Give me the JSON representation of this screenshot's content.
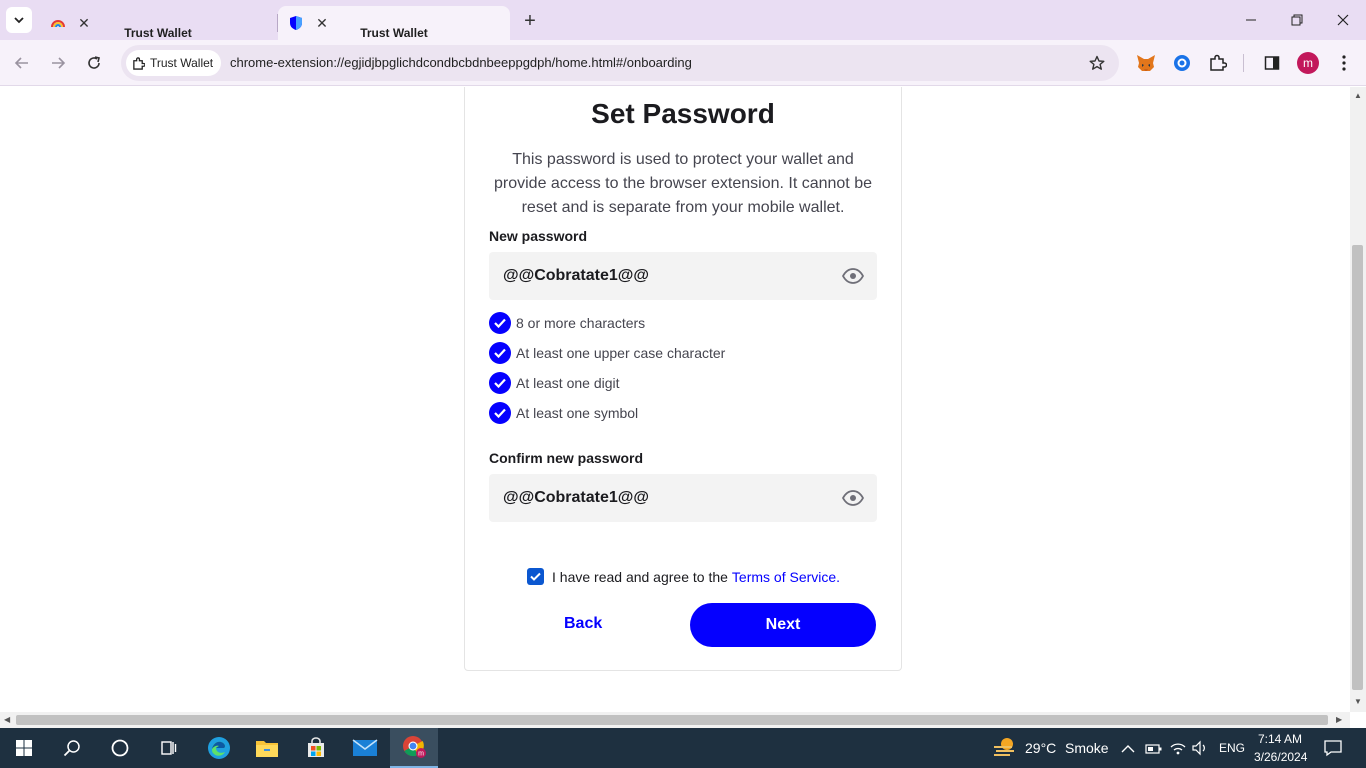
{
  "browser": {
    "tabs": [
      {
        "title": "Trust Wallet",
        "active": false
      },
      {
        "title": "Trust Wallet",
        "active": true
      }
    ],
    "site_chip": "Trust Wallet",
    "url": "chrome-extension://egjidjbpglichdcondbcbdnbeeppgdph/home.html#/onboarding",
    "profile_initial": "m"
  },
  "page": {
    "title": "Set Password",
    "description": "This password is used to protect your wallet and provide access to the browser extension. It cannot be reset and is separate from your mobile wallet.",
    "new_password": {
      "label": "New password",
      "value": "@@Cobratate1@@"
    },
    "rules": [
      {
        "text": "8 or more characters",
        "met": true
      },
      {
        "text": "At least one upper case character",
        "met": true
      },
      {
        "text": "At least one digit",
        "met": true
      },
      {
        "text": "At least one symbol",
        "met": true
      }
    ],
    "confirm_password": {
      "label": "Confirm new password",
      "value": "@@Cobratate1@@"
    },
    "terms": {
      "text": "I have read and agree to the",
      "link": "Terms of Service.",
      "checked": true
    },
    "back_label": "Back",
    "next_label": "Next"
  },
  "taskbar": {
    "weather_temp": "29°C",
    "weather_desc": "Smoke",
    "language": "ENG",
    "time": "7:14 AM",
    "date": "3/26/2024"
  },
  "colors": {
    "accent": "#0500ff",
    "tabstrip": "#e9ddf3",
    "taskbar": "#1e3040"
  }
}
